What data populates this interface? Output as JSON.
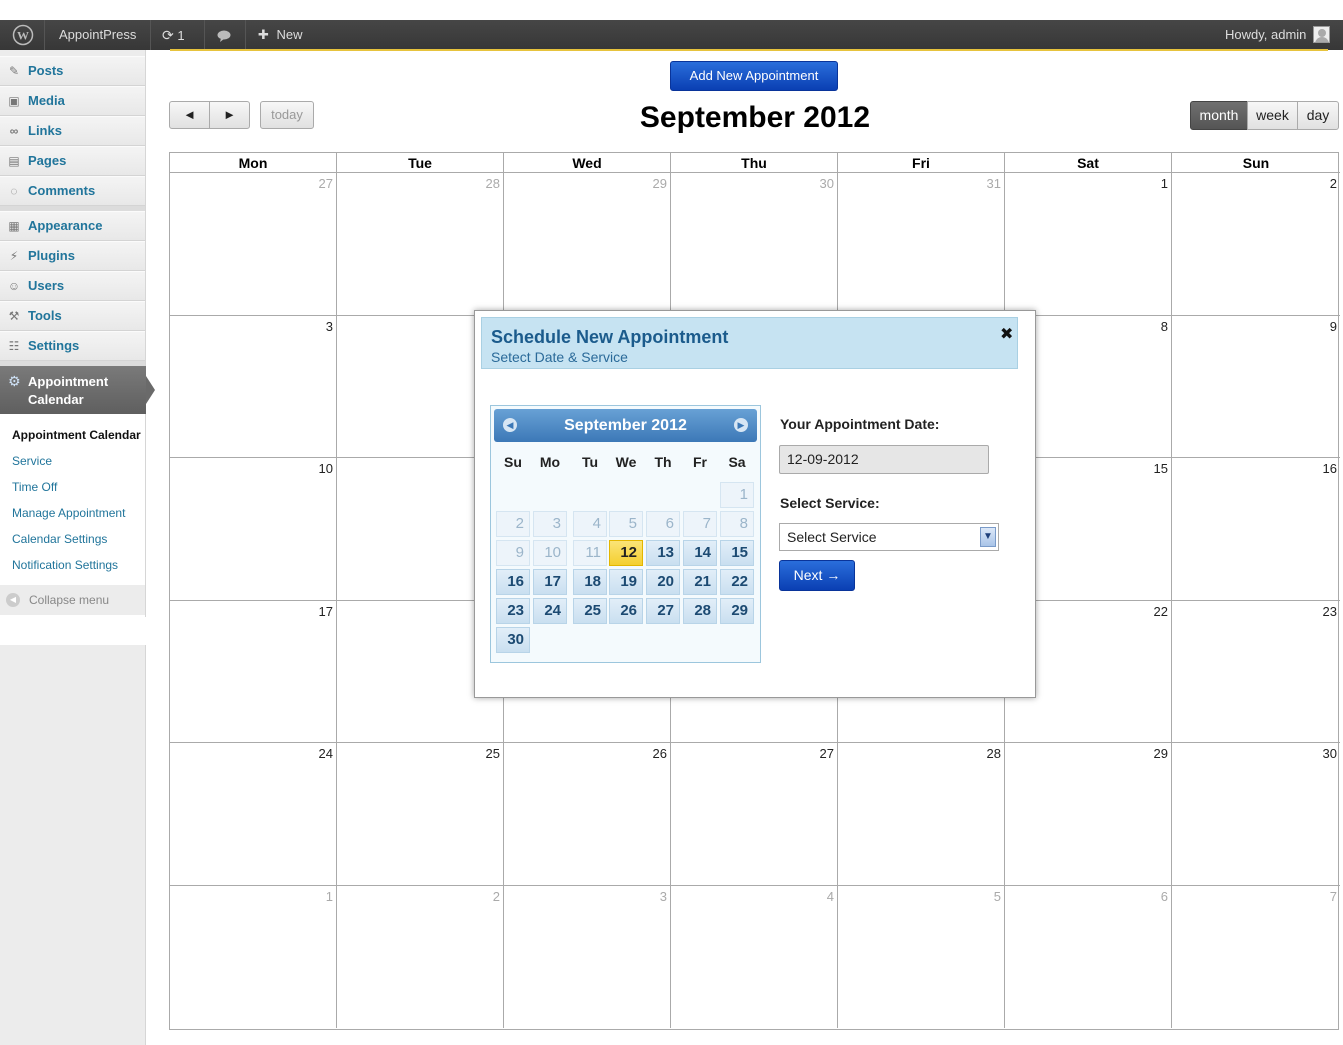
{
  "adminbar": {
    "site_name": "AppointPress",
    "updates_count": "1",
    "new_label": "New",
    "howdy": "Howdy, admin"
  },
  "sidebar": {
    "items": [
      {
        "label": "Posts",
        "icon": "pin-icon"
      },
      {
        "label": "Media",
        "icon": "media-icon"
      },
      {
        "label": "Links",
        "icon": "link-icon"
      },
      {
        "label": "Pages",
        "icon": "pages-icon"
      },
      {
        "label": "Comments",
        "icon": "comment-icon"
      },
      {
        "label": "Appearance",
        "icon": "appearance-icon"
      },
      {
        "label": "Plugins",
        "icon": "plugin-icon"
      },
      {
        "label": "Users",
        "icon": "users-icon"
      },
      {
        "label": "Tools",
        "icon": "tools-icon"
      },
      {
        "label": "Settings",
        "icon": "settings-icon"
      }
    ],
    "active": {
      "line1": "Appointment",
      "line2": "Calendar"
    },
    "submenu": [
      "Appointment Calendar",
      "Service",
      "Time Off",
      "Manage Appointment",
      "Calendar Settings",
      "Notification Settings"
    ],
    "collapse": "Collapse menu"
  },
  "toolbar": {
    "add_button": "Add New Appointment",
    "prev": "◄",
    "next": "►",
    "today": "today",
    "title": "September 2012",
    "views": [
      "month",
      "week",
      "day"
    ],
    "active_view": "month"
  },
  "calendar": {
    "weekdays": [
      "Mon",
      "Tue",
      "Wed",
      "Thu",
      "Fri",
      "Sat",
      "Sun"
    ],
    "weeks": [
      [
        {
          "d": "27",
          "o": true
        },
        {
          "d": "28",
          "o": true
        },
        {
          "d": "29",
          "o": true
        },
        {
          "d": "30",
          "o": true
        },
        {
          "d": "31",
          "o": true
        },
        {
          "d": "1",
          "o": false
        },
        {
          "d": "2",
          "o": false
        }
      ],
      [
        {
          "d": "3",
          "o": false
        },
        {
          "d": "",
          "o": false
        },
        {
          "d": "",
          "o": false
        },
        {
          "d": "",
          "o": false
        },
        {
          "d": "",
          "o": false
        },
        {
          "d": "8",
          "o": false
        },
        {
          "d": "9",
          "o": false
        }
      ],
      [
        {
          "d": "10",
          "o": false
        },
        {
          "d": "",
          "o": false
        },
        {
          "d": "",
          "o": false
        },
        {
          "d": "",
          "o": false
        },
        {
          "d": "",
          "o": false
        },
        {
          "d": "15",
          "o": false
        },
        {
          "d": "16",
          "o": false
        }
      ],
      [
        {
          "d": "17",
          "o": false
        },
        {
          "d": "",
          "o": false
        },
        {
          "d": "",
          "o": false
        },
        {
          "d": "",
          "o": false
        },
        {
          "d": "",
          "o": false
        },
        {
          "d": "22",
          "o": false
        },
        {
          "d": "23",
          "o": false
        }
      ],
      [
        {
          "d": "24",
          "o": false
        },
        {
          "d": "25",
          "o": false
        },
        {
          "d": "26",
          "o": false
        },
        {
          "d": "27",
          "o": false
        },
        {
          "d": "28",
          "o": false
        },
        {
          "d": "29",
          "o": false
        },
        {
          "d": "30",
          "o": false
        }
      ],
      [
        {
          "d": "1",
          "o": true
        },
        {
          "d": "2",
          "o": true
        },
        {
          "d": "3",
          "o": true
        },
        {
          "d": "4",
          "o": true
        },
        {
          "d": "5",
          "o": true
        },
        {
          "d": "6",
          "o": true
        },
        {
          "d": "7",
          "o": true
        }
      ]
    ]
  },
  "modal": {
    "title": "Schedule New Appointment",
    "subtitle": "Setect Date & Service",
    "close": "✖",
    "datepicker": {
      "title": "September 2012",
      "weekdays": [
        "Su",
        "Mo",
        "Tu",
        "We",
        "Th",
        "Fr",
        "Sa"
      ],
      "rows": [
        [
          "",
          "",
          "",
          "",
          "",
          "",
          "1"
        ],
        [
          "2",
          "3",
          "4",
          "5",
          "6",
          "7",
          "8"
        ],
        [
          "9",
          "10",
          "11",
          "12",
          "13",
          "14",
          "15"
        ],
        [
          "16",
          "17",
          "18",
          "19",
          "20",
          "21",
          "22"
        ],
        [
          "23",
          "24",
          "25",
          "26",
          "27",
          "28",
          "29"
        ],
        [
          "30",
          "",
          "",
          "",
          "",
          "",
          ""
        ]
      ],
      "disabled_through": 11,
      "selected": "12"
    },
    "date_label": "Your Appointment Date:",
    "date_value": "12-09-2012",
    "service_label": "Select Service:",
    "service_value": "Select Service",
    "next_button": "Next →"
  }
}
